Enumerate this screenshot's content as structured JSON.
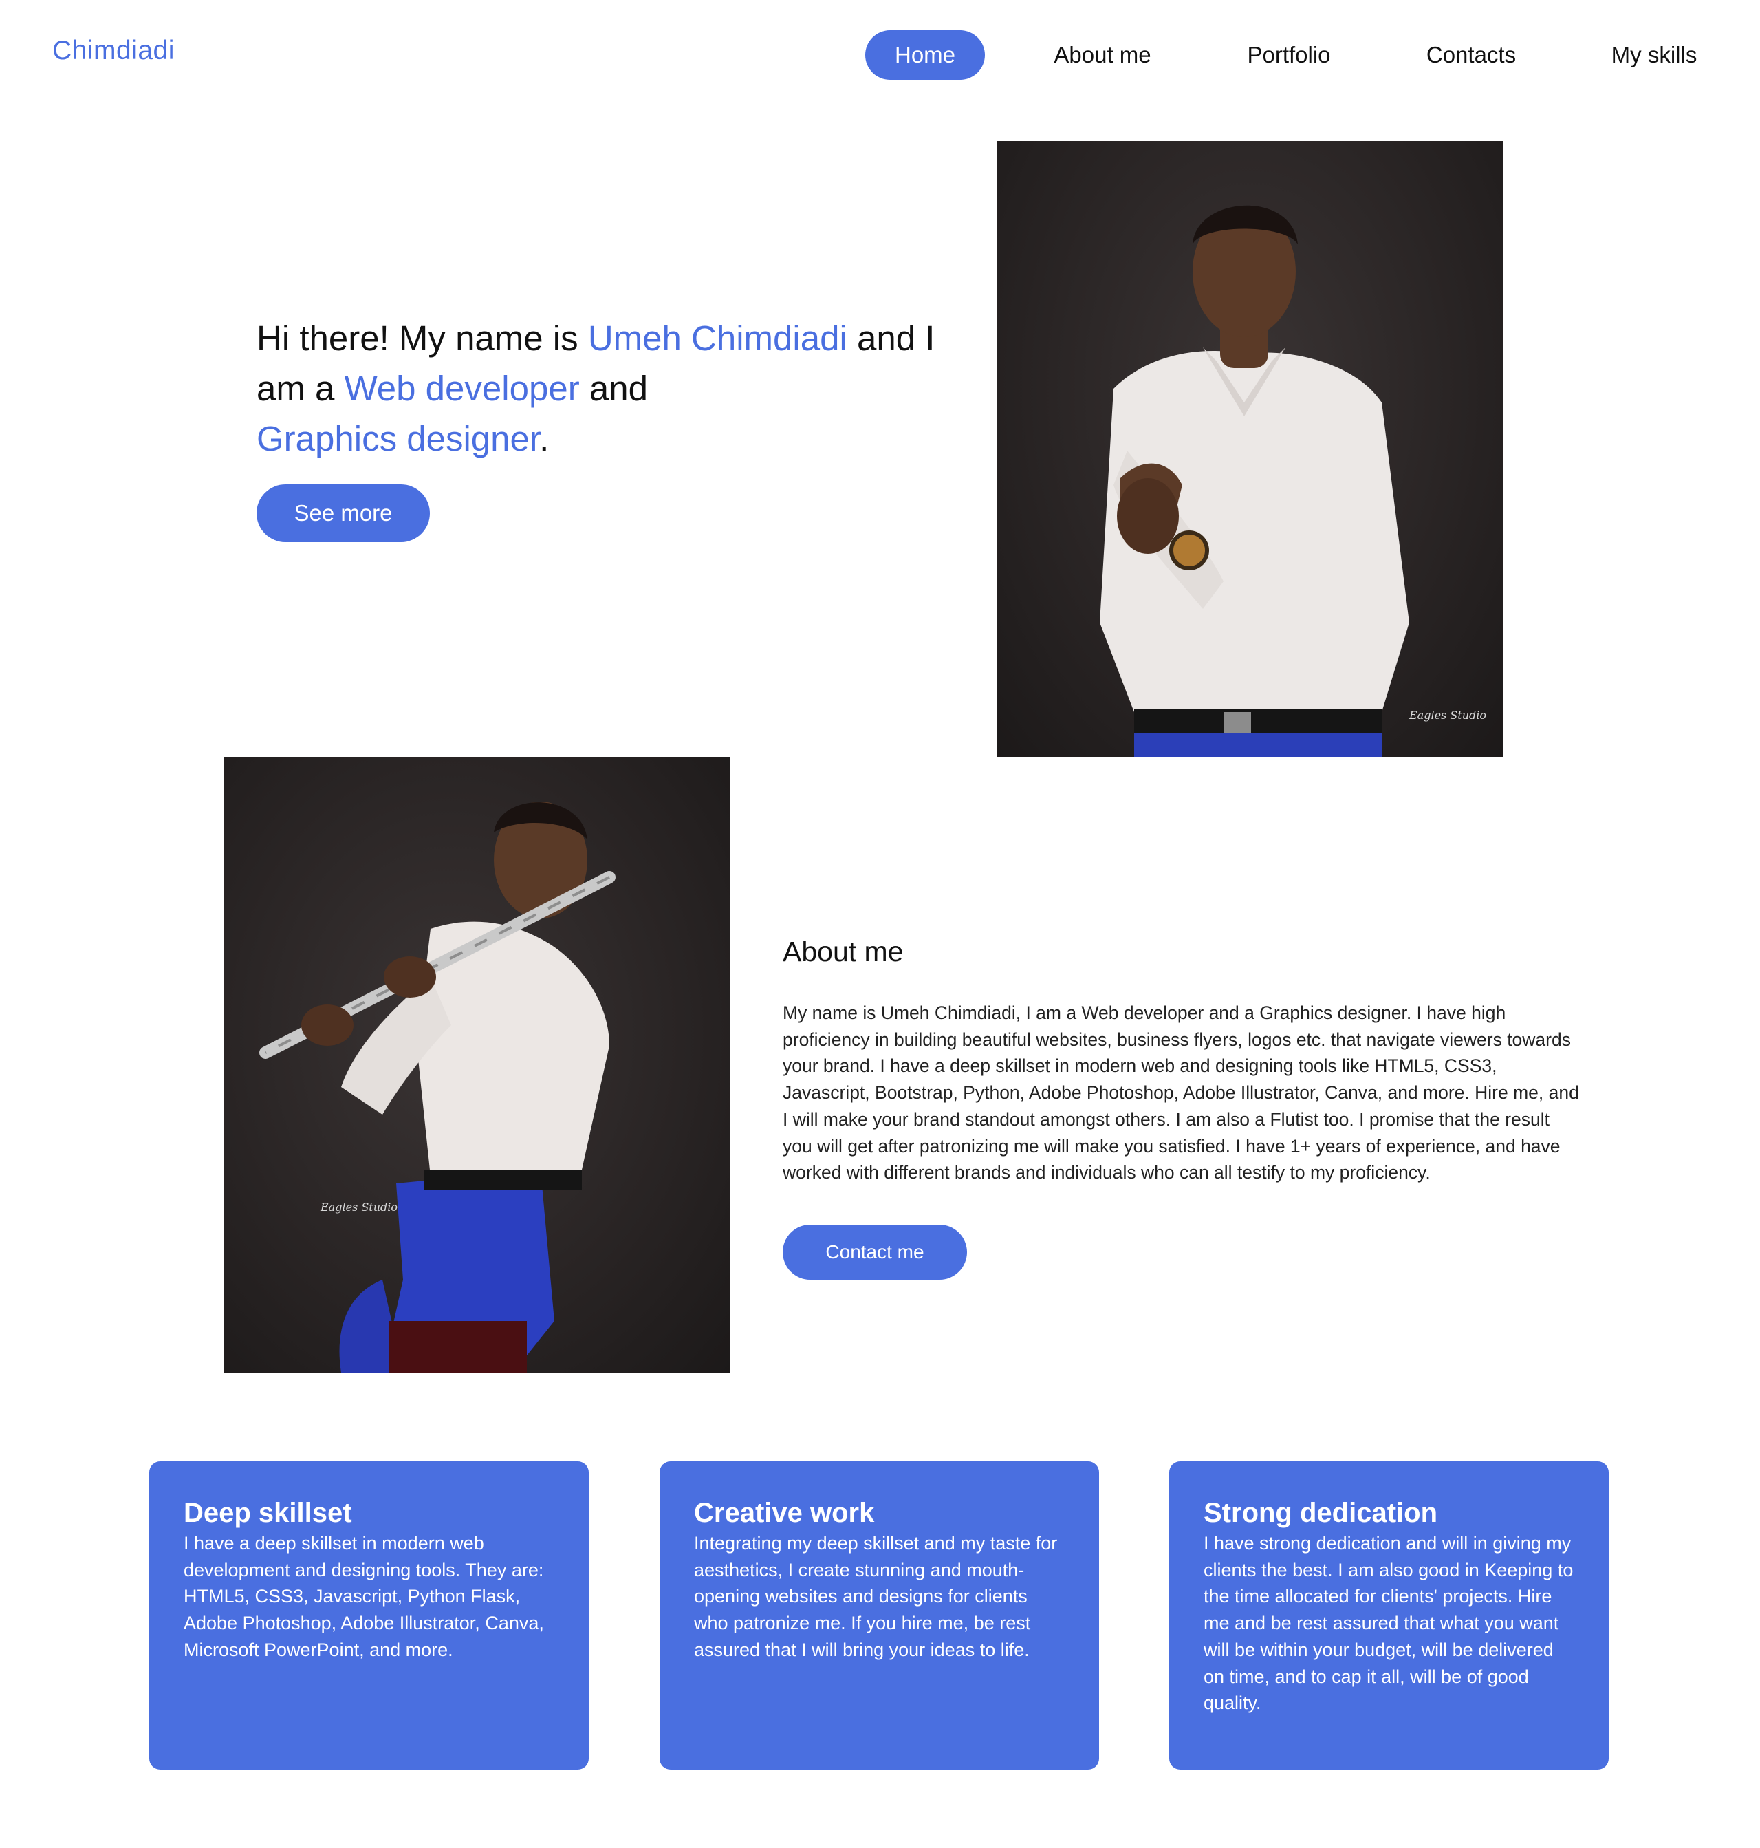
{
  "header": {
    "logo": "Chimdiadi",
    "nav": [
      {
        "label": "Home",
        "active": true
      },
      {
        "label": "About me",
        "active": false
      },
      {
        "label": "Portfolio",
        "active": false
      },
      {
        "label": "Contacts",
        "active": false
      },
      {
        "label": "My skills",
        "active": false
      }
    ]
  },
  "hero": {
    "intro_1": "Hi there! My name is ",
    "name": "Umeh Chimdiadi",
    "intro_2": " and I am a ",
    "role_1": "Web developer",
    "intro_3": " and ",
    "role_2": "Graphics designer",
    "intro_4": ".",
    "button": "See more",
    "photo_watermark": "Eagles Studio"
  },
  "about": {
    "heading": "About me",
    "body": "My name is Umeh Chimdiadi, I am a Web developer and a Graphics designer. I have high proficiency in building beautiful websites, business flyers, logos etc. that navigate viewers towards your brand. I have a deep skillset in modern web and designing tools like HTML5, CSS3, Javascript, Bootstrap, Python, Adobe Photoshop, Adobe Illustrator, Canva, and more. Hire me, and I will make your brand standout amongst others. I am also a Flutist too. I promise that the result you will get after patronizing me will make you satisfied. I have 1+ years of experience, and have worked with different brands and individuals who can all testify to my proficiency.",
    "button": "Contact me",
    "photo_watermark": "Eagles Studio"
  },
  "cards": [
    {
      "title": "Deep skillset",
      "body": "I have a deep skillset in modern web development and designing tools. They are: HTML5, CSS3, Javascript, Python Flask, Adobe Photoshop, Adobe Illustrator, Canva, Microsoft PowerPoint, and more."
    },
    {
      "title": "Creative work",
      "body": "Integrating my deep skillset and my taste for aesthetics, I create stunning and mouth-opening websites and designs for clients who patronize me. If you hire me, be rest assured that I will bring your ideas to life."
    },
    {
      "title": "Strong dedication",
      "body": "I have strong dedication and will in giving my clients the best. I am also good in Keeping to the time allocated for clients' projects. Hire me and be rest assured that what you want will be within your budget, will be delivered on time, and to cap it all, will be of good quality."
    }
  ],
  "colors": {
    "accent": "#4a6fe0",
    "text": "#111111",
    "background": "#ffffff"
  }
}
